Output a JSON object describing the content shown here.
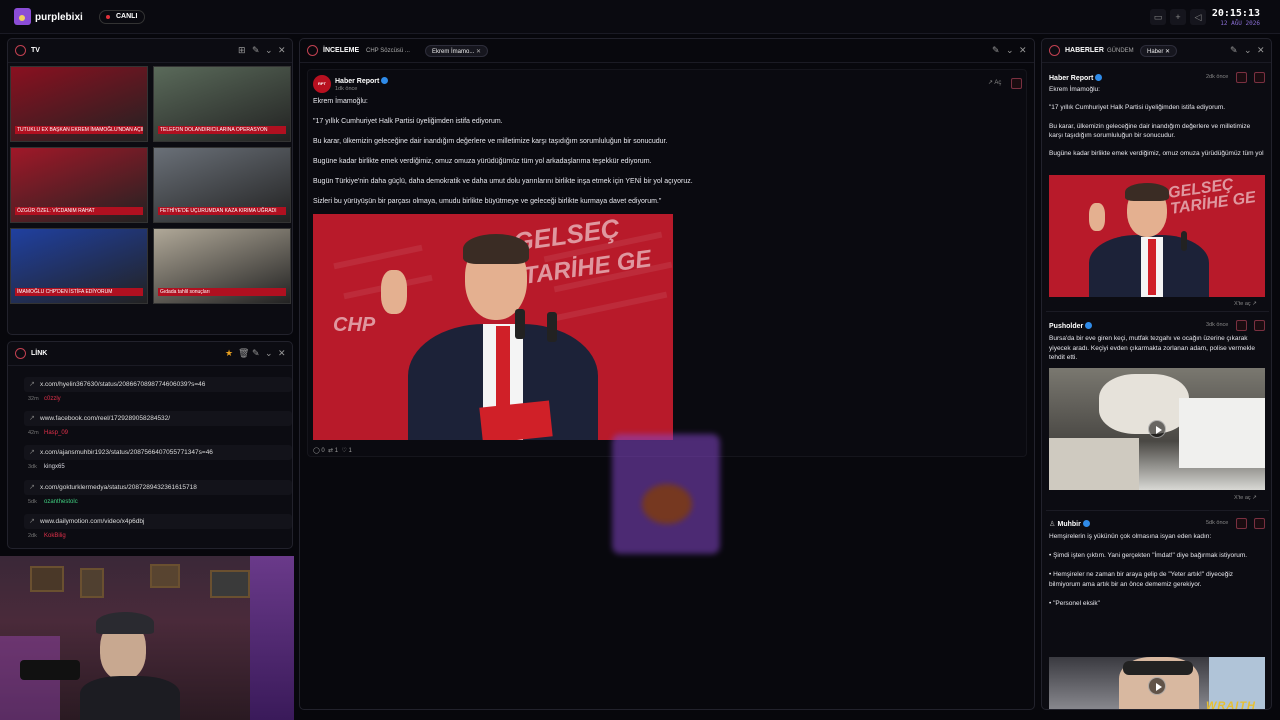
{
  "app": {
    "brand": "purplebixi",
    "live": "CANLI",
    "time": "20:15:13",
    "date": "12 AĞU 2026"
  },
  "topbar": {
    "btns": [
      "▭",
      "+",
      "◁"
    ]
  },
  "tv_panel": {
    "title": "TV",
    "tiles": [
      {
        "caption": "TUTUKLU EX BAŞKAN EKREM İMAMOĞLU'NDAN AÇIKLAMA",
        "bg": "#8a1020"
      },
      {
        "caption": "TELEFON DOLANDIRICILARINA OPERASYON",
        "bg": "#5a6a5a"
      },
      {
        "caption": "ÖZGÜR ÖZEL: VİCDANIM RAHAT",
        "bg": "#a01828"
      },
      {
        "caption": "FETHİYE'DE UÇURUMDAN KAZA KIRIMA UĞRADI",
        "bg": "#6a7078"
      },
      {
        "caption": "İMAMOĞLU CHP'DEN İSTİFA EDİYORUM",
        "bg": "#2040a0"
      },
      {
        "caption": "Gıdada tahlil sonuçları",
        "bg": "#b0a898"
      }
    ]
  },
  "link_panel": {
    "title": "LİNK",
    "items": [
      {
        "url": "x.com/hyelin367630/status/2086670898774606039?s=46",
        "age": "32m",
        "user": "c0zzly",
        "color": "#e0304a"
      },
      {
        "url": "www.facebook.com/reel/1729289058284532/",
        "age": "42m",
        "user": "Hasp_09",
        "color": "#e0304a"
      },
      {
        "url": "x.com/ajansmuhbir1923/status/2087566407055771347s=46",
        "age": "3dk",
        "user": "kingx65",
        "color": "#d8d8e0"
      },
      {
        "url": "x.com/gokturklermedya/status/2087289432361615718",
        "age": "5dk",
        "user": "ozanthestolc",
        "color": "#40d080"
      },
      {
        "url": "www.dailymotion.com/video/x4p6dbj",
        "age": "2dk",
        "user": "KokBilig",
        "color": "#e0304a"
      }
    ]
  },
  "inceleme": {
    "title": "İNCELEME",
    "tabs": [
      {
        "label": "CHP Sözcüsü ..."
      },
      {
        "label": "Ekrem İmamo..."
      }
    ],
    "post": {
      "author": "Haber Report",
      "avatar": "RPT",
      "time": "1dk önce",
      "open": "Aç",
      "text": "Ekrem İmamoğlu:\n\n\"17 yıllık Cumhuriyet Halk Partisi üyeliğimden istifa ediyorum.\n\nBu karar, ülkemizin geleceğine dair inandığım değerlere ve milletimize karşı taşıdığım sorumluluğun bir sonucudur.\n\nBugüne kadar birlikte emek verdiğimiz, omuz omuza yürüdüğümüz tüm yol arkadaşlarıma teşekkür ediyorum.\n\nBugün Türkiye'nin daha güçlü, daha demokratik ve daha umut dolu yarınlarını birlikte inşa etmek için YENİ bir yol açıyoruz.\n\nSizleri bu yürüyüşün bir parçası olmaya, umudu birlikte büyütmeye ve geleceği birlikte kurmaya davet ediyorum.\"",
      "image_text_1": "GELSEÇ",
      "image_text_2": "TARİHE GE",
      "image_text_3": "CHP",
      "replies": "0",
      "retweets": "1",
      "likes": "1"
    }
  },
  "haberler": {
    "title": "HABERLER",
    "tabs": [
      {
        "label": "GÜNDEM"
      },
      {
        "label": "Haber"
      }
    ],
    "items": [
      {
        "author": "Haber Report",
        "time": "2dk önce",
        "text": "Ekrem İmamoğlu:\n\n\"17 yıllık Cumhuriyet Halk Partisi üyeliğimden istifa ediyorum.\n\nBu karar, ülkemizin geleceğine dair inandığım değerlere ve milletimize karşı taşıdığım sorumluluğun bir sonucudur.\n\nBugüne kadar birlikte emek verdiğimiz, omuz omuza yürüdüğümüz tüm yol",
        "image_text": "GELSEÇ TARİHE GE",
        "link": "X'te aç ↗"
      },
      {
        "author": "Pusholder",
        "time": "3dk önce",
        "text": "Bursa'da bir eve giren keçi, mutfak tezgahı ve ocağın üzerine çıkarak yiyecek aradı. Keçiyi evden çıkarmakta zorlanan adam, polise vermekle tehdit etti.",
        "link": "X'te aç ↗"
      },
      {
        "author": "Muhbir",
        "time": "5dk önce",
        "text": "Hemşirelerin iş yükünün çok olmasına isyan eden kadın:\n\n• Şimdi işten çıktım. Yani gerçekten \"İmdat!\" diye bağırmak istiyorum.\n\n• Hemşireler ne zaman bir araya gelip de \"Yeter artık!\" diyeceğiz bilmiyorum ama artık bir an önce dememiz gerekiyor.\n\n• \"Personel eksik\""
      }
    ]
  },
  "webcam": {
    "overlay": "WRAITH"
  }
}
